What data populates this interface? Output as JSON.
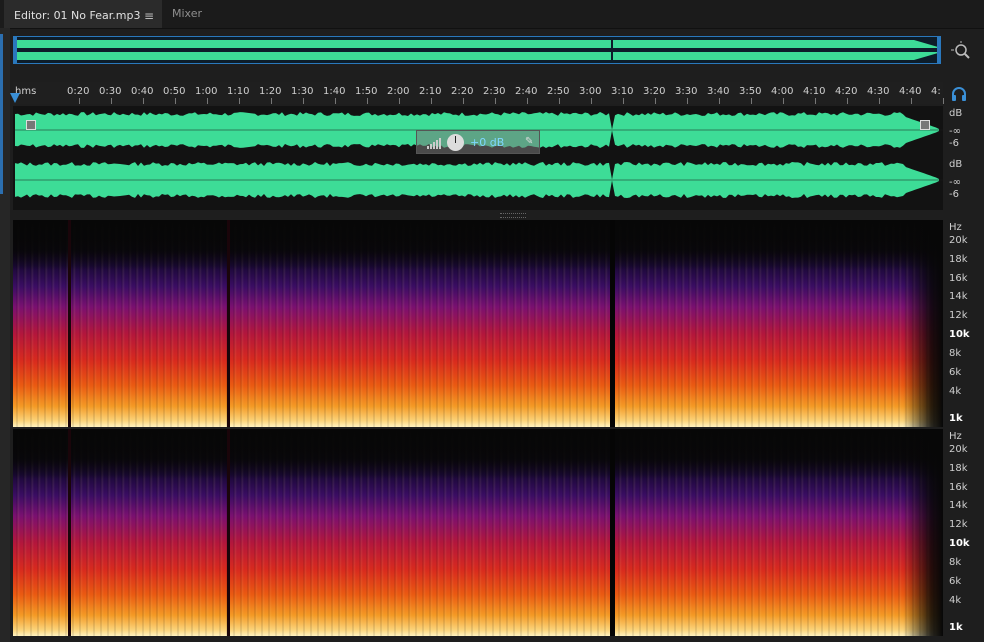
{
  "tabs": {
    "editor_label": "Editor: 01 No Fear.mp3",
    "menu_glyph": "≡",
    "mixer_label": "Mixer"
  },
  "ruler": {
    "unit": "hms",
    "ticks": [
      "0:20",
      "0:30",
      "0:40",
      "0:50",
      "1:00",
      "1:10",
      "1:20",
      "1:30",
      "1:40",
      "1:50",
      "2:00",
      "2:10",
      "2:20",
      "2:30",
      "2:40",
      "2:50",
      "3:00",
      "3:10",
      "3:20",
      "3:30",
      "3:40",
      "3:50",
      "4:00",
      "4:10",
      "4:20",
      "4:30",
      "4:40",
      "4:"
    ]
  },
  "amplitude_scale": {
    "unit": "dB",
    "labels": [
      "-∞",
      "-6"
    ]
  },
  "hud": {
    "value": "+0 dB"
  },
  "frequency_scale": {
    "unit": "Hz",
    "labels": [
      "20k",
      "18k",
      "16k",
      "14k",
      "12k",
      "10k",
      "8k",
      "6k",
      "4k",
      "1k"
    ]
  },
  "icons": {
    "zoom": "zoom-selection-icon",
    "headphones": "headphones-icon",
    "pin": "pin-icon",
    "volume": "volume-bars-icon",
    "knob": "gain-knob-icon"
  },
  "colors": {
    "waveform": "#3ddc97",
    "overview_border": "#2a78bd",
    "accent_blue": "#3a8fd6"
  }
}
